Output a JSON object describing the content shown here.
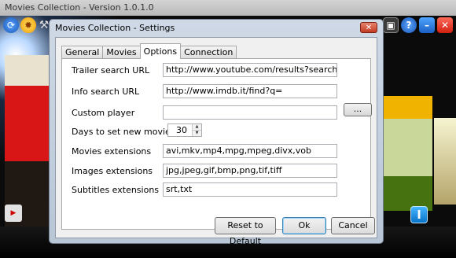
{
  "app": {
    "title": "Movies Collection - Version 1.0.1.0"
  },
  "dialog": {
    "title": "Movies Collection - Settings",
    "close_glyph": "✕",
    "tabs": [
      {
        "label": "General",
        "active": false
      },
      {
        "label": "Movies",
        "active": false
      },
      {
        "label": "Options",
        "active": true
      },
      {
        "label": "Connection",
        "active": false
      }
    ],
    "fields": {
      "trailer_search_url": {
        "label": "Trailer search URL",
        "value": "http://www.youtube.com/results?search_query=l"
      },
      "info_search_url": {
        "label": "Info search URL",
        "value": "http://www.imdb.it/find?q="
      },
      "custom_player": {
        "label": "Custom player",
        "value": "",
        "browse_label": "..."
      },
      "days_new_movie": {
        "label": "Days to set new movie",
        "value": "30"
      },
      "movies_extensions": {
        "label": "Movies extensions",
        "value": "avi,mkv,mp4,mpg,mpeg,divx,vob"
      },
      "images_extensions": {
        "label": "Images extensions",
        "value": "jpg,jpeg,gif,bmp,png,tif,tiff"
      },
      "subtitles_extensions": {
        "label": "Subtitles extensions",
        "value": "srt,txt"
      }
    },
    "buttons": {
      "reset": "Reset to Default",
      "ok": "Ok",
      "cancel": "Cancel"
    }
  },
  "icons": {
    "refresh": "refresh-icon",
    "sun": "sun-icon",
    "tool": "wrench-icon",
    "film": "film-icon",
    "help": "help-icon",
    "minimize": "minimize-icon",
    "close": "close-icon",
    "youtube": "youtube-icon",
    "info": "info-icon"
  },
  "colors": {
    "dialog_frame": "#cfd9e6",
    "close_button": "#c23b22",
    "info_button": "#0872c8"
  }
}
